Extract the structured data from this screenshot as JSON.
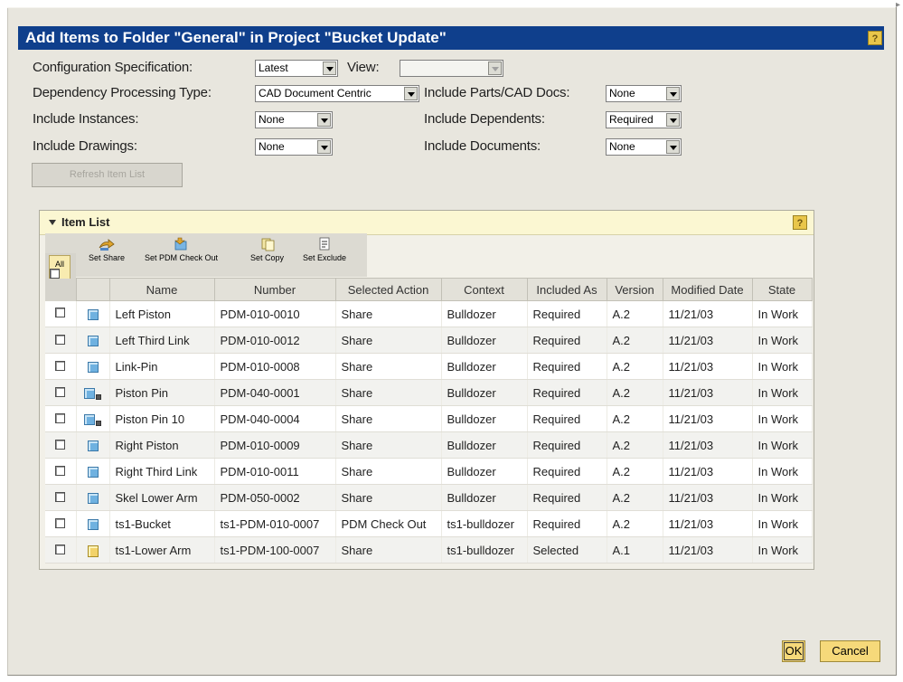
{
  "dialog": {
    "title": "Add Items to Folder \"General\" in Project \"Bucket Update\"",
    "help_label": "?"
  },
  "form": {
    "config_spec_label": "Configuration Specification:",
    "config_spec_value": "Latest",
    "view_label": "View:",
    "view_value": "",
    "dependency_label": "Dependency Processing Type:",
    "dependency_value": "CAD Document Centric",
    "include_parts_label": "Include Parts/CAD Docs:",
    "include_parts_value": "None",
    "include_instances_label": "Include Instances:",
    "include_instances_value": "None",
    "include_dependents_label": "Include Dependents:",
    "include_dependents_value": "Required",
    "include_drawings_label": "Include Drawings:",
    "include_drawings_value": "None",
    "include_documents_label": "Include Documents:",
    "include_documents_value": "None",
    "refresh_label": "Refresh Item List"
  },
  "item_list": {
    "title": "Item List",
    "help_label": "?",
    "all_label": "All",
    "toolbar": [
      {
        "label": "Set Share",
        "icon": "set-share-icon"
      },
      {
        "label": "Set PDM Check Out",
        "icon": "set-pdm-checkout-icon"
      },
      {
        "label": "Set Copy",
        "icon": "set-copy-icon"
      },
      {
        "label": "Set Exclude",
        "icon": "set-exclude-icon"
      }
    ],
    "columns": [
      "Name",
      "Number",
      "Selected Action",
      "Context",
      "Included As",
      "Version",
      "Modified Date",
      "State"
    ],
    "rows": [
      {
        "icon": "part-icon",
        "badge": "",
        "name": "Left Piston",
        "number": "PDM-010-0010",
        "action": "Share",
        "context": "Bulldozer",
        "included_as": "Required",
        "version": "A.2",
        "modified": "11/21/03",
        "state": "In Work"
      },
      {
        "icon": "part-icon",
        "badge": "",
        "name": "Left Third Link",
        "number": "PDM-010-0012",
        "action": "Share",
        "context": "Bulldozer",
        "included_as": "Required",
        "version": "A.2",
        "modified": "11/21/03",
        "state": "In Work"
      },
      {
        "icon": "part-icon",
        "badge": "",
        "name": "Link-Pin",
        "number": "PDM-010-0008",
        "action": "Share",
        "context": "Bulldozer",
        "included_as": "Required",
        "version": "A.2",
        "modified": "11/21/03",
        "state": "In Work"
      },
      {
        "icon": "part-icon",
        "badge": "generic",
        "name": "Piston Pin",
        "number": "PDM-040-0001",
        "action": "Share",
        "context": "Bulldozer",
        "included_as": "Required",
        "version": "A.2",
        "modified": "11/21/03",
        "state": "In Work"
      },
      {
        "icon": "part-icon",
        "badge": "instance",
        "name": "Piston Pin 10",
        "number": "PDM-040-0004",
        "action": "Share",
        "context": "Bulldozer",
        "included_as": "Required",
        "version": "A.2",
        "modified": "11/21/03",
        "state": "In Work"
      },
      {
        "icon": "part-icon",
        "badge": "",
        "name": "Right Piston",
        "number": "PDM-010-0009",
        "action": "Share",
        "context": "Bulldozer",
        "included_as": "Required",
        "version": "A.2",
        "modified": "11/21/03",
        "state": "In Work"
      },
      {
        "icon": "part-icon",
        "badge": "",
        "name": "Right Third Link",
        "number": "PDM-010-0011",
        "action": "Share",
        "context": "Bulldozer",
        "included_as": "Required",
        "version": "A.2",
        "modified": "11/21/03",
        "state": "In Work"
      },
      {
        "icon": "part-icon",
        "badge": "",
        "name": "Skel Lower Arm",
        "number": "PDM-050-0002",
        "action": "Share",
        "context": "Bulldozer",
        "included_as": "Required",
        "version": "A.2",
        "modified": "11/21/03",
        "state": "In Work"
      },
      {
        "icon": "part-icon",
        "badge": "",
        "name": "ts1-Bucket",
        "number": "ts1-PDM-010-0007",
        "action": "PDM Check Out",
        "context": "ts1-bulldozer",
        "included_as": "Required",
        "version": "A.2",
        "modified": "11/21/03",
        "state": "In Work"
      },
      {
        "icon": "doc-icon",
        "badge": "",
        "name": "ts1-Lower Arm",
        "number": "ts1-PDM-100-0007",
        "action": "Share",
        "context": "ts1-bulldozer",
        "included_as": "Selected",
        "version": "A.1",
        "modified": "11/21/03",
        "state": "In Work"
      }
    ]
  },
  "buttons": {
    "ok_label": "OK",
    "cancel_label": "Cancel"
  },
  "colors": {
    "title_bar": "#0f3f8c",
    "dialog_bg": "#e8e6de",
    "panel_header": "#fbf7d2",
    "button_yellow": "#f6d97a"
  }
}
